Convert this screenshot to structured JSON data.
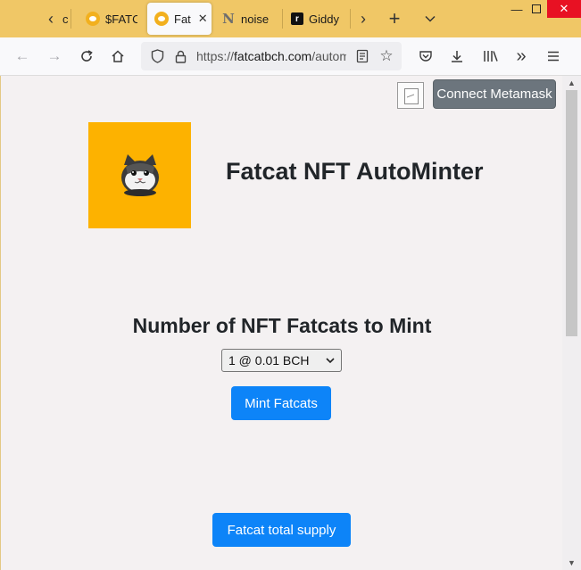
{
  "browser": {
    "tabs": [
      {
        "title": "$FATC",
        "favicon": "fatcat-icon",
        "active": false
      },
      {
        "title": "Fat",
        "favicon": "fatcat-icon",
        "active": true
      },
      {
        "title": "noise",
        "favicon": "noise-n-icon",
        "active": false
      },
      {
        "title": "Giddy",
        "favicon": "giddy-r-icon",
        "active": false
      }
    ],
    "cut_tab_text": "c",
    "tab_close_glyph": "✕",
    "giddy_favicon_letter": "r",
    "noise_favicon_letter": "N",
    "url": {
      "scheme": "https://",
      "host": "fatcatbch.com",
      "path": "/autom"
    }
  },
  "page": {
    "connect_button_label": "Connect Metamask",
    "title": "Fatcat NFT AutoMinter",
    "mint_heading": "Number of NFT Fatcats to Mint",
    "mint_select": {
      "selected": "1 @ 0.01 BCH"
    },
    "mint_button_label": "Mint Fatcats",
    "supply_button_label": "Fatcat total supply"
  },
  "colors": {
    "tabstrip": "#f0c766",
    "logo_bg": "#fdb200",
    "primary_button": "#0d84f8",
    "secondary_button": "#6c757d"
  }
}
